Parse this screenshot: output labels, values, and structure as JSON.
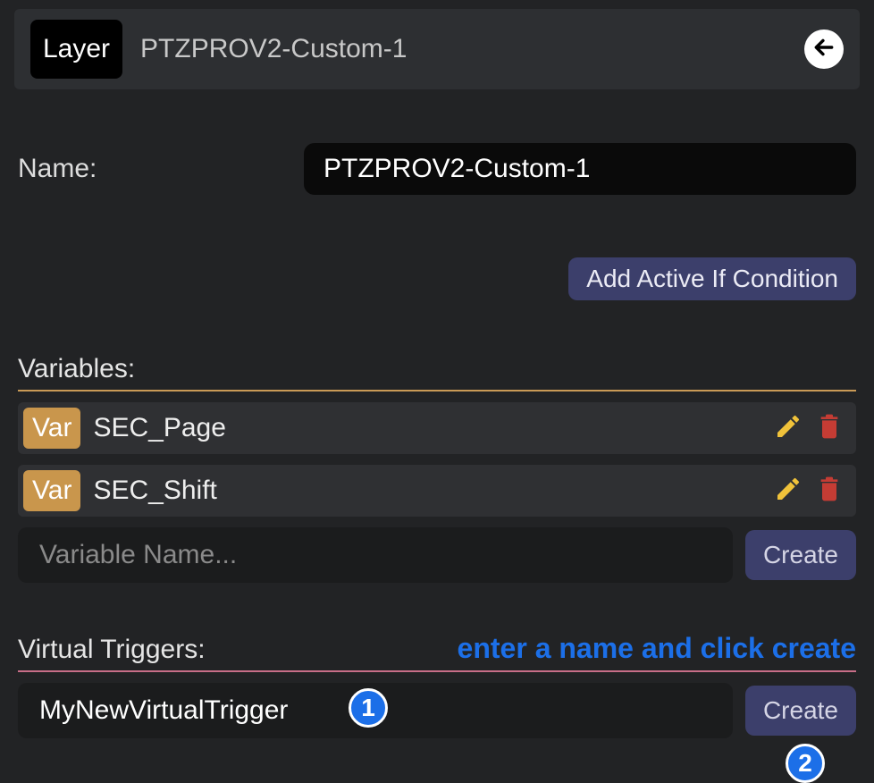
{
  "header": {
    "badge": "Layer",
    "title": "PTZPROV2-Custom-1"
  },
  "name_section": {
    "label": "Name:",
    "value": "PTZPROV2-Custom-1"
  },
  "condition_button": "Add Active If Condition",
  "variables_section": {
    "heading": "Variables:",
    "badge_label": "Var",
    "items": [
      {
        "name": "SEC_Page"
      },
      {
        "name": "SEC_Shift"
      }
    ],
    "new_placeholder": "Variable Name...",
    "create_label": "Create"
  },
  "triggers_section": {
    "heading": "Virtual Triggers:",
    "annotation": "enter a name and click create",
    "new_value": "MyNewVirtualTrigger",
    "create_label": "Create",
    "badge1": "1",
    "badge2": "2"
  },
  "colors": {
    "accent_orange": "#c9964c",
    "accent_pink": "#c86e88",
    "accent_blue": "#1c6fe8",
    "button_purple": "#3c3f6b"
  }
}
